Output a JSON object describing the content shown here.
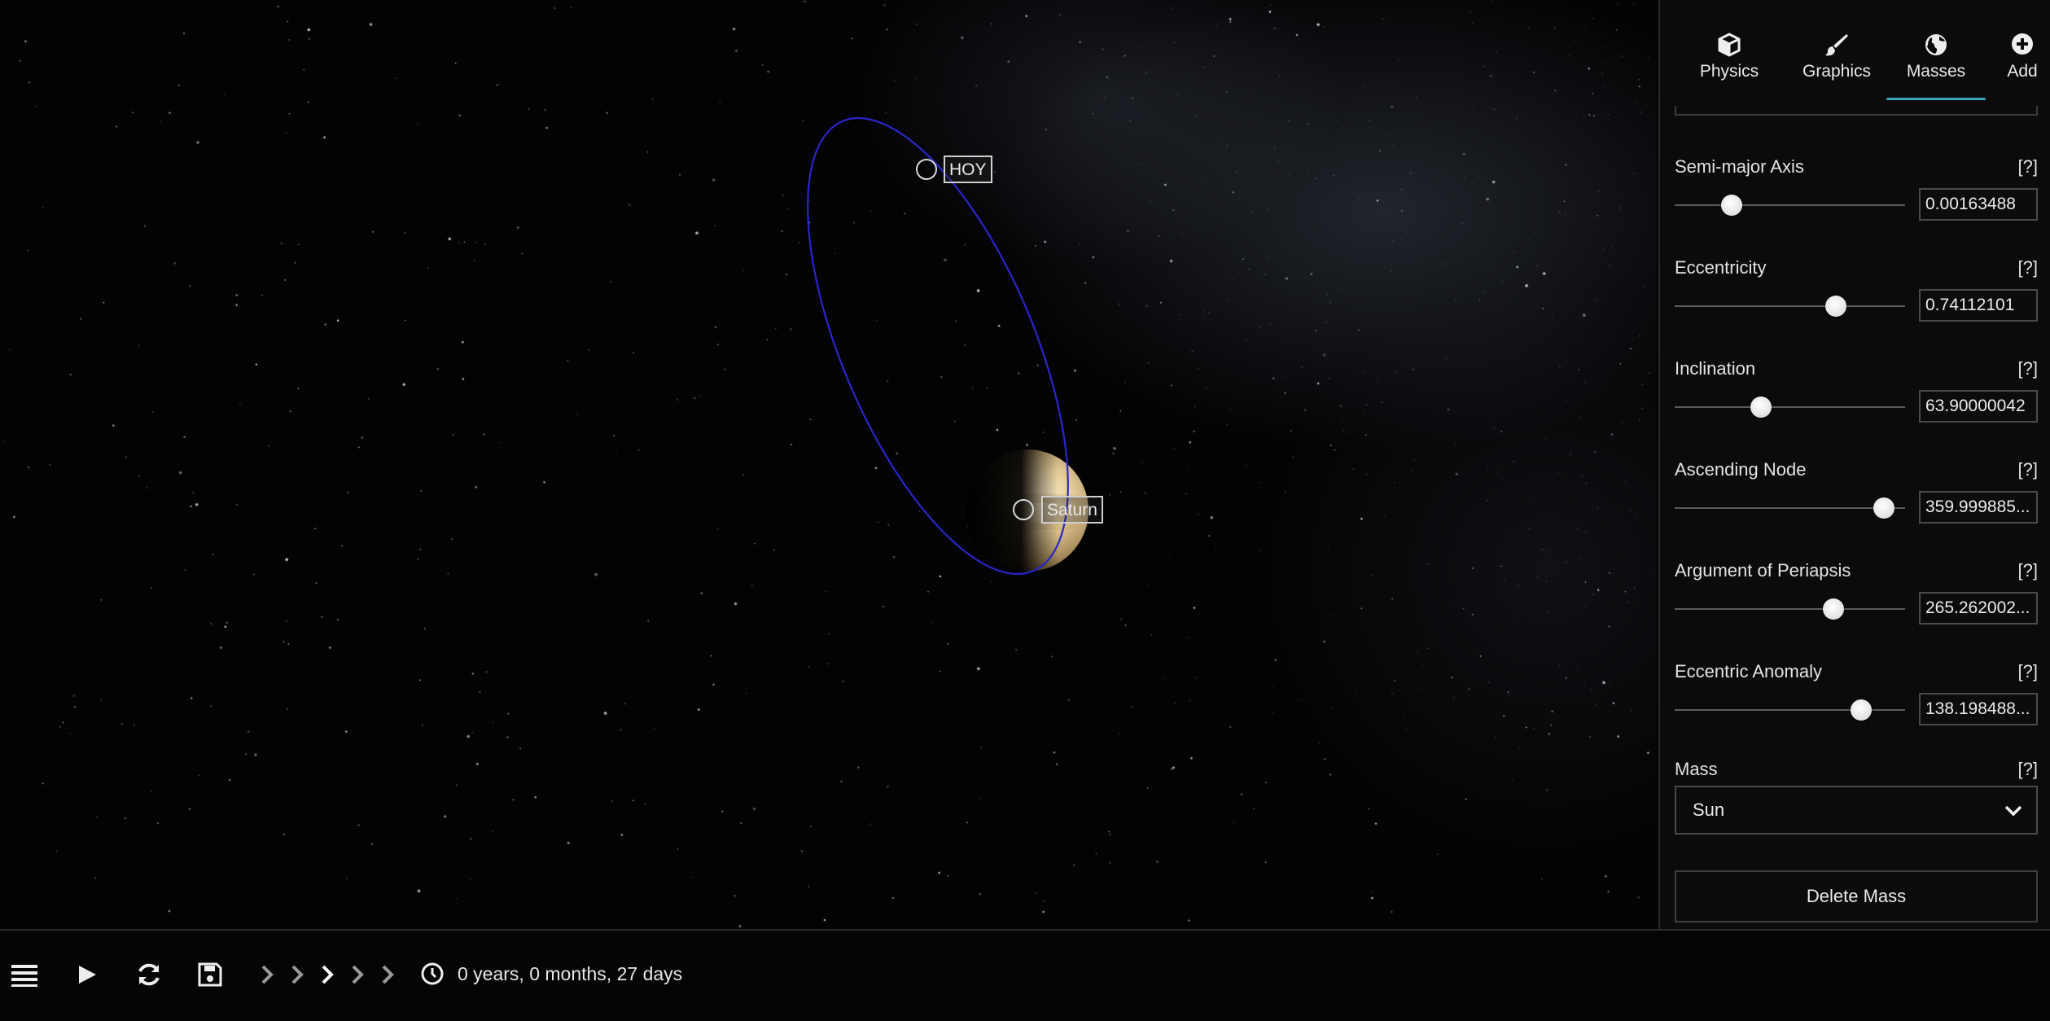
{
  "viewport": {
    "bodies": [
      {
        "name": "HOY"
      },
      {
        "name": "Saturn"
      }
    ],
    "orbit_color": "#2a25c9"
  },
  "sidebar": {
    "tabs": [
      {
        "label": "Physics",
        "icon": "cube-icon",
        "active": false
      },
      {
        "label": "Graphics",
        "icon": "paintbrush-icon",
        "active": false
      },
      {
        "label": "Masses",
        "icon": "globe-icon",
        "active": true
      },
      {
        "label": "Add",
        "icon": "plus-circle-icon",
        "active": false
      }
    ],
    "params": [
      {
        "label": "Semi-major Axis",
        "help": "[?]",
        "value": "0.00163488",
        "slider_fraction": 0.22
      },
      {
        "label": "Eccentricity",
        "help": "[?]",
        "value": "0.74112101",
        "slider_fraction": 0.72
      },
      {
        "label": "Inclination",
        "help": "[?]",
        "value": "63.90000042",
        "slider_fraction": 0.36
      },
      {
        "label": "Ascending Node",
        "help": "[?]",
        "value": "359.999885...",
        "slider_fraction": 0.95
      },
      {
        "label": "Argument of Periapsis",
        "help": "[?]",
        "value": "265.262002...",
        "slider_fraction": 0.71
      },
      {
        "label": "Eccentric Anomaly",
        "help": "[?]",
        "value": "138.198488...",
        "slider_fraction": 0.84
      }
    ],
    "mass": {
      "label": "Mass",
      "help": "[?]",
      "selected": "Sun"
    },
    "delete_label": "Delete Mass"
  },
  "bottombar": {
    "buttons": [
      "menu-icon",
      "play-icon",
      "reset-icon",
      "save-icon"
    ],
    "speed_levels": 5,
    "speed_active": 3,
    "time": "0 years, 0 months, 27 days"
  },
  "colors": {
    "accent": "#3aa1c1",
    "panel_bg": "#0b0b0c"
  }
}
